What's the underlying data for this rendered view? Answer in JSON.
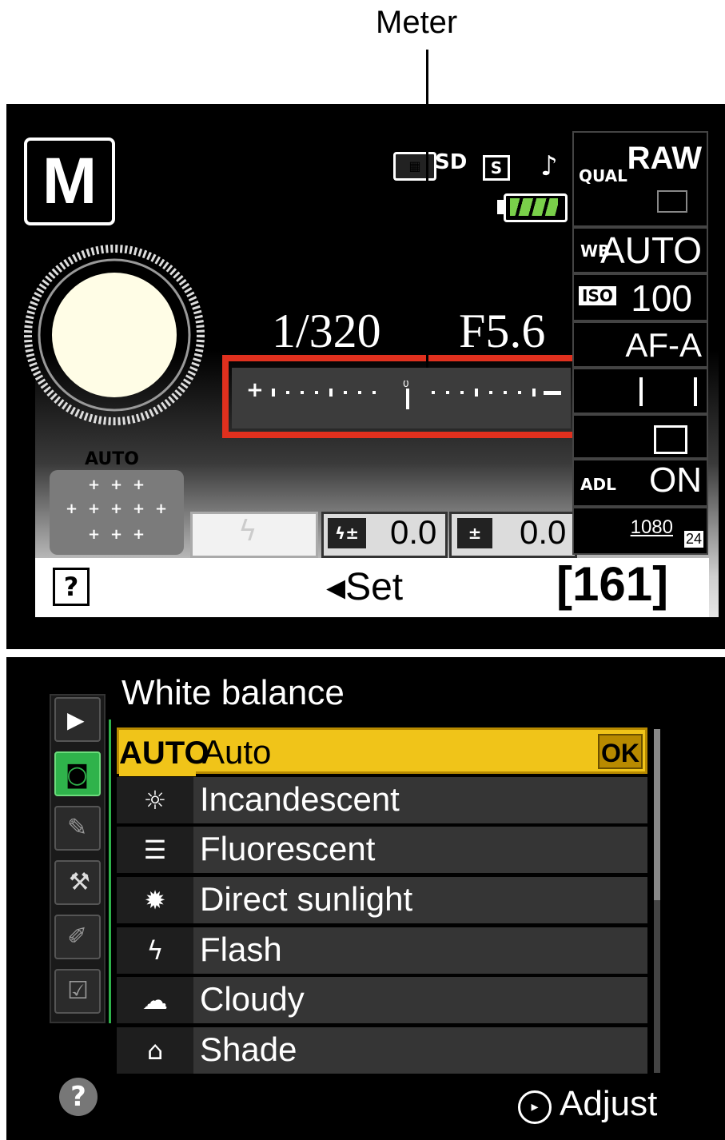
{
  "callout": {
    "label": "Meter"
  },
  "top_screen": {
    "mode": "M",
    "shutter": "1/320",
    "aperture": "F5.6",
    "auto_label": "AUTO",
    "flash_comp_value": "0.0",
    "exposure_comp_value": "0.0",
    "help": "?",
    "set_label": "Set",
    "set_arrow": "◂",
    "shots_remaining": "[161]",
    "right_panel": {
      "qual_label": "QUAL",
      "qual_value": "RAW",
      "wb_label": "WB",
      "wb_value": "AUTO",
      "iso_label": "ISO",
      "iso_value": "100",
      "af_mode": "AF-A",
      "adl_label": "ADL",
      "adl_value": "ON",
      "movie_res": "1080",
      "movie_fps": "24"
    },
    "meter": {
      "plus": "+",
      "minus": "−",
      "zero": "0",
      "exposure_offset": 0
    }
  },
  "menu": {
    "title": "White balance",
    "items": [
      {
        "icon": "AUTO",
        "label": "Auto",
        "selected": true
      },
      {
        "icon": "☼",
        "label": "Incandescent"
      },
      {
        "icon": "☰",
        "label": "Fluorescent"
      },
      {
        "icon": "✹",
        "label": "Direct sunlight"
      },
      {
        "icon": "ϟ",
        "label": "Flash"
      },
      {
        "icon": "☁",
        "label": "Cloudy"
      },
      {
        "icon": "⌂",
        "label": "Shade"
      }
    ],
    "ok": "OK",
    "help": "?",
    "adjust": "Adjust",
    "active_tab_color": "#2fb34b",
    "selected_color": "#f0c419"
  }
}
